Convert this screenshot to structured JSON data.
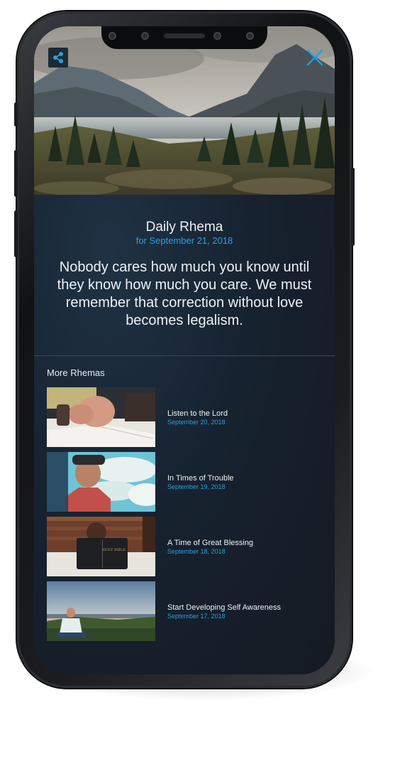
{
  "header": {
    "title": "Daily Rhema",
    "date": "for September 21, 2018"
  },
  "quote": "Nobody cares how much you know until they know how much you care. We must remember that correction without love becomes legalism.",
  "more_section": {
    "label": "More Rhemas",
    "items": [
      {
        "title": "Listen to the Lord",
        "date": "September 20, 2018",
        "image": "praying-hands-bible-image"
      },
      {
        "title": "In Times of Trouble",
        "date": "September 19, 2018",
        "image": "man-looking-at-sky-image"
      },
      {
        "title": "A Time of Great Blessing",
        "date": "September 18, 2018",
        "image": "child-reading-bible-image"
      },
      {
        "title": "Start Developing Self Awareness",
        "date": "September 17, 2018",
        "image": "man-meditating-sunset-image"
      }
    ]
  },
  "icons": {
    "share": "share-icon",
    "close": "close-icon"
  },
  "colors": {
    "accent": "#2a9fe0",
    "background": "#172230",
    "text": "#eef1f4"
  }
}
